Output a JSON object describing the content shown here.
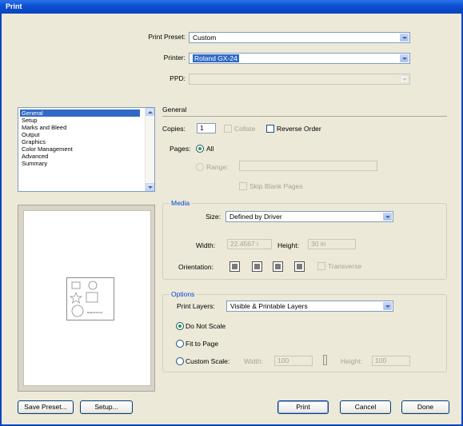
{
  "window": {
    "title": "Print"
  },
  "top": {
    "preset_label": "Print Preset:",
    "preset_value": "Custom",
    "printer_label": "Printer:",
    "printer_value": "Roland GX-24",
    "ppd_label": "PPD:",
    "ppd_value": ""
  },
  "categories": [
    "General",
    "Setup",
    "Marks and Bleed",
    "Output",
    "Graphics",
    "Color Management",
    "Advanced",
    "Summary"
  ],
  "selected_category": "General",
  "general": {
    "heading": "General",
    "copies_label": "Copies:",
    "copies_value": "1",
    "collate_label": "Collate",
    "reverse_order_label": "Reverse Order",
    "pages_label": "Pages:",
    "all_label": "All",
    "range_label": "Range:",
    "range_value": "",
    "skip_blank_label": "Skip Blank Pages"
  },
  "media": {
    "heading": "Media",
    "size_label": "Size:",
    "size_value": "Defined by Driver",
    "width_label": "Width:",
    "width_value": "22.4567 i",
    "height_label": "Height:",
    "height_value": "30 in",
    "orientation_label": "Orientation:",
    "transverse_label": "Transverse"
  },
  "options": {
    "heading": "Options",
    "print_layers_label": "Print Layers:",
    "print_layers_value": "Visible & Printable Layers",
    "do_not_scale_label": "Do Not Scale",
    "fit_to_page_label": "Fit to Page",
    "custom_scale_label": "Custom Scale:",
    "cs_width_label": "Width:",
    "cs_width_value": "100",
    "cs_height_label": "Height:",
    "cs_height_value": "100"
  },
  "preview": {
    "thumb_text": "Roland GX-24"
  },
  "buttons": {
    "save_preset": "Save Preset...",
    "setup": "Setup...",
    "print": "Print",
    "cancel": "Cancel",
    "done": "Done"
  }
}
